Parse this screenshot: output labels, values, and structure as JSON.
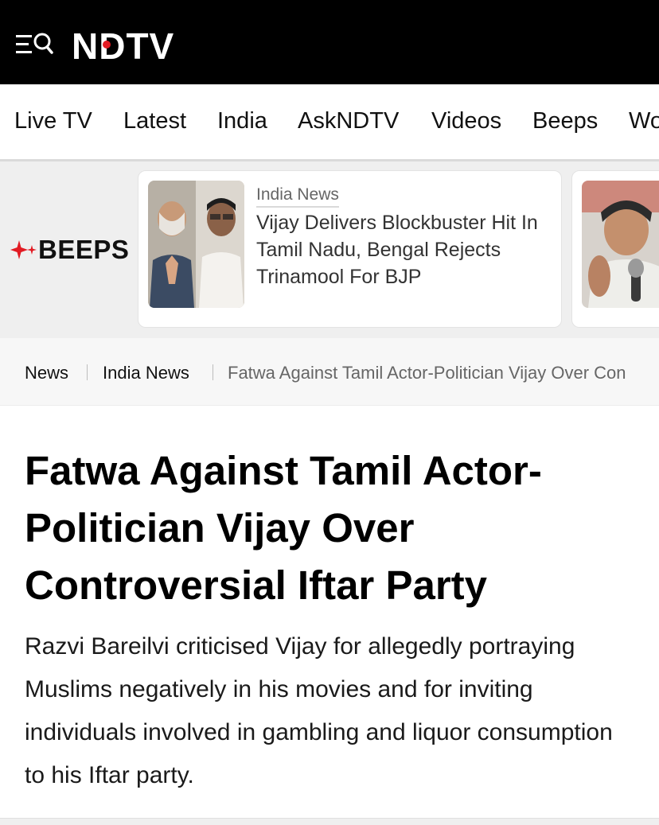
{
  "brand": {
    "logo_text": "NDTV",
    "header_bg": "#000000",
    "accent": "#e21b23"
  },
  "header": {
    "menu_search_icon": "menu-search-icon"
  },
  "nav": {
    "items": [
      {
        "label": "Live TV"
      },
      {
        "label": "Latest"
      },
      {
        "label": "India"
      },
      {
        "label": "AskNDTV"
      },
      {
        "label": "Videos"
      },
      {
        "label": "Beeps"
      },
      {
        "label": "Wo"
      }
    ]
  },
  "beeps": {
    "label": "BEEPS",
    "icon": "sparkle-icon",
    "cards": [
      {
        "category": "India News",
        "title": "Vijay Delivers Blockbuster Hit In Tamil Nadu, Bengal Rejects Trinamool For BJP",
        "thumbnail": "two-politicians-photo"
      },
      {
        "thumbnail": "woman-speaking-at-microphone-photo"
      }
    ]
  },
  "breadcrumb": {
    "items": [
      {
        "label": "News"
      },
      {
        "label": "India News"
      },
      {
        "label": "Fatwa Against Tamil Actor-Politician Vijay Over Con"
      }
    ]
  },
  "article": {
    "headline": "Fatwa Against Tamil Actor-Politician Vijay Over Controversial Iftar Party",
    "summary": "Razvi Bareilvi criticised Vijay for allegedly portraying Muslims negatively in his movies and for inviting individuals involved in gambling and liquor consumption to his Iftar party."
  }
}
